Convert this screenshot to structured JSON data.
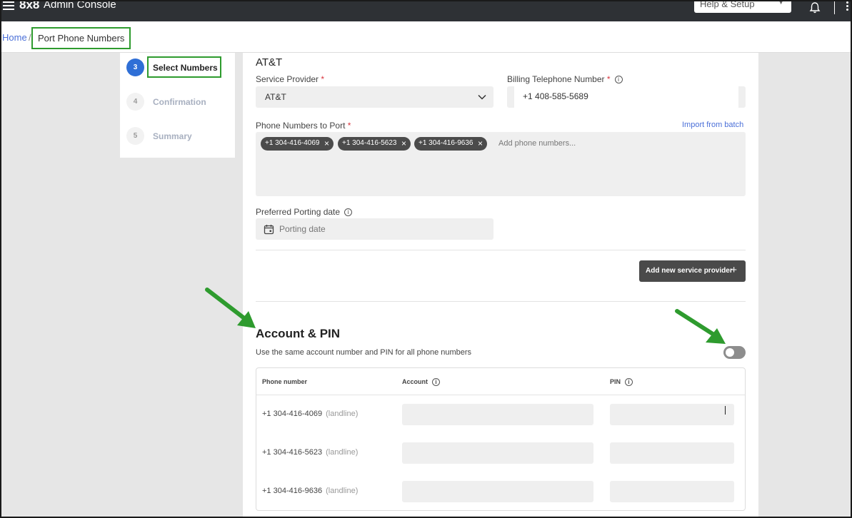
{
  "topbar": {
    "brand": "8x8",
    "title": "Admin Console",
    "help_label": "Help & Setup"
  },
  "breadcrumb": {
    "home": "Home",
    "separator": "/",
    "current": "Port Phone Numbers"
  },
  "stepper": {
    "steps": [
      {
        "number": "3",
        "label": "Select Numbers",
        "state": "active"
      },
      {
        "number": "4",
        "label": "Confirmation",
        "state": "inactive"
      },
      {
        "number": "5",
        "label": "Summary",
        "state": "inactive"
      }
    ]
  },
  "provider": {
    "title": "AT&T",
    "service_provider_label": "Service Provider",
    "required_mark": "*",
    "service_provider_value": "AT&T",
    "billing_label": "Billing Telephone Number",
    "billing_value": "+1 408-585-5689",
    "phones_label": "Phone Numbers to Port",
    "import_link": "Import from batch",
    "chips": [
      "+1 304-416-4069",
      "+1 304-416-5623",
      "+1 304-416-9636"
    ],
    "phones_placeholder": "Add phone numbers...",
    "porting_label": "Preferred Porting date",
    "porting_placeholder": "Porting date",
    "add_provider_label": "Add new service provider"
  },
  "account_pin": {
    "title": "Account & PIN",
    "subtitle": "Use the same account number and PIN for all phone numbers",
    "toggle_on": false,
    "headers": {
      "phone": "Phone number",
      "account": "Account",
      "pin": "PIN"
    },
    "rows": [
      {
        "phone": "+1 304-416-4069",
        "type": "(landline)"
      },
      {
        "phone": "+1 304-416-5623",
        "type": "(landline)"
      },
      {
        "phone": "+1 304-416-9636",
        "type": "(landline)"
      }
    ]
  },
  "colors": {
    "accent": "#2f6fd6",
    "annotation": "#2e9b2e",
    "topbar": "#2e3135"
  }
}
